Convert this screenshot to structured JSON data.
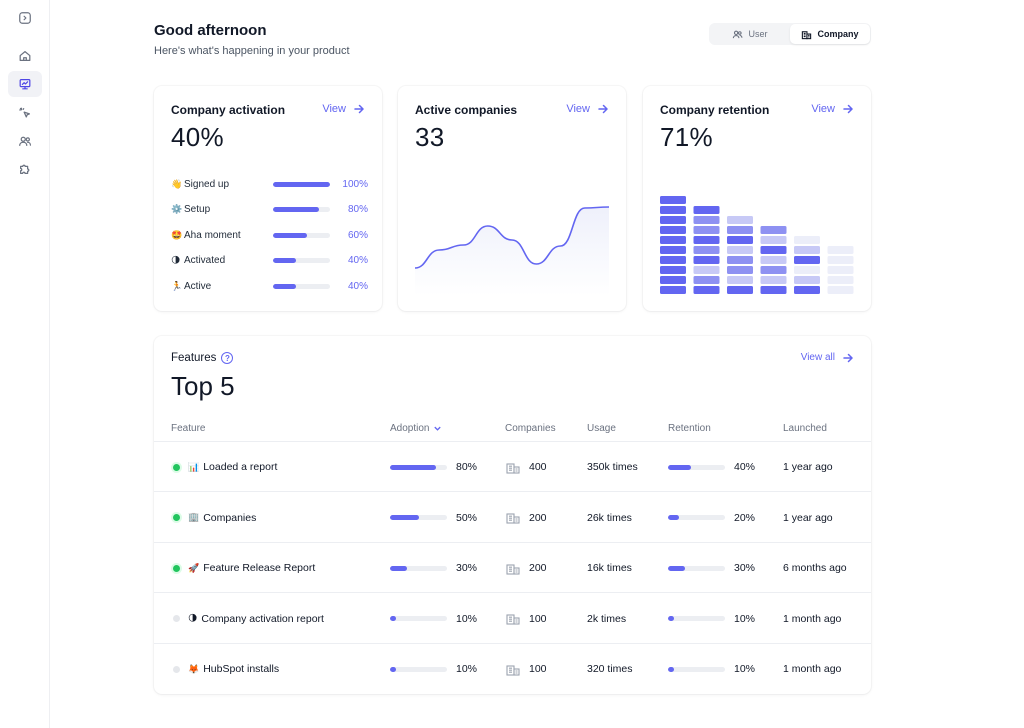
{
  "header": {
    "greeting": "Good afternoon",
    "subtitle": "Here's what's happening in your product",
    "toggle": {
      "user_label": "User",
      "company_label": "Company",
      "selected": "Company"
    }
  },
  "sidebar": {
    "items": [
      {
        "icon": "collapse-icon"
      },
      {
        "icon": "home-icon"
      },
      {
        "icon": "presentation-icon",
        "active": true
      },
      {
        "icon": "cursor-click-icon"
      },
      {
        "icon": "users-icon"
      },
      {
        "icon": "puzzle-icon"
      }
    ]
  },
  "cards": {
    "activation": {
      "title": "Company activation",
      "view_label": "View",
      "value": "40%",
      "funnel": [
        {
          "emoji": "👋",
          "label": "Signed up",
          "percent": 100,
          "percent_label": "100%"
        },
        {
          "emoji": "⚙️",
          "label": "Setup",
          "percent": 80,
          "percent_label": "80%"
        },
        {
          "emoji": "🤩",
          "label": "Aha moment",
          "percent": 60,
          "percent_label": "60%"
        },
        {
          "emoji": "🌗",
          "label": "Activated",
          "percent": 40,
          "percent_label": "40%"
        },
        {
          "emoji": "🏃",
          "label": "Active",
          "percent": 40,
          "percent_label": "40%"
        }
      ]
    },
    "active_companies": {
      "title": "Active companies",
      "view_label": "View",
      "value": "33"
    },
    "retention": {
      "title": "Company retention",
      "view_label": "View",
      "value": "71%"
    }
  },
  "features": {
    "title": "Features",
    "headline": "Top 5",
    "view_all_label": "View all",
    "columns": {
      "feature": "Feature",
      "adoption": "Adoption",
      "companies": "Companies",
      "usage": "Usage",
      "retention": "Retention",
      "launched": "Launched"
    },
    "rows": [
      {
        "status": "on",
        "emoji": "📊",
        "name": "Loaded a report",
        "adoption": 80,
        "adoption_label": "80%",
        "companies": "400",
        "usage": "350k times",
        "retention": 40,
        "retention_label": "40%",
        "launched": "1 year ago"
      },
      {
        "status": "on",
        "emoji": "🏢",
        "name": "Companies",
        "adoption": 50,
        "adoption_label": "50%",
        "companies": "200",
        "usage": "26k times",
        "retention": 20,
        "retention_label": "20%",
        "launched": "1 year ago"
      },
      {
        "status": "on",
        "emoji": "🚀",
        "name": "Feature Release Report",
        "adoption": 30,
        "adoption_label": "30%",
        "companies": "200",
        "usage": "16k times",
        "retention": 30,
        "retention_label": "30%",
        "launched": "6 months ago"
      },
      {
        "status": "off",
        "emoji": "🌗",
        "name": "Company activation report",
        "adoption": 10,
        "adoption_label": "10%",
        "companies": "100",
        "usage": "2k times",
        "retention": 10,
        "retention_label": "10%",
        "launched": "1 month ago"
      },
      {
        "status": "off",
        "emoji": "🦊",
        "name": "HubSpot installs",
        "adoption": 10,
        "adoption_label": "10%",
        "companies": "100",
        "usage": "320 times",
        "retention": 10,
        "retention_label": "10%",
        "launched": "1 month ago"
      }
    ]
  },
  "chart_data": [
    {
      "type": "area",
      "series": [
        {
          "values": [
            22,
            40,
            45,
            64,
            50,
            26,
            44,
            82,
            83
          ]
        }
      ],
      "ylim": [
        0,
        100
      ],
      "colors": {
        "line": "#6366f1",
        "fill": "#eef0fb"
      }
    },
    {
      "type": "bar",
      "values": [
        10,
        9,
        8,
        7,
        6,
        5
      ],
      "ylim": [
        0,
        10
      ],
      "colors": {
        "strong": "#6366f1",
        "medium": "#8e91f2",
        "light": "#c7c9f6",
        "faint": "#eceef9"
      }
    }
  ]
}
